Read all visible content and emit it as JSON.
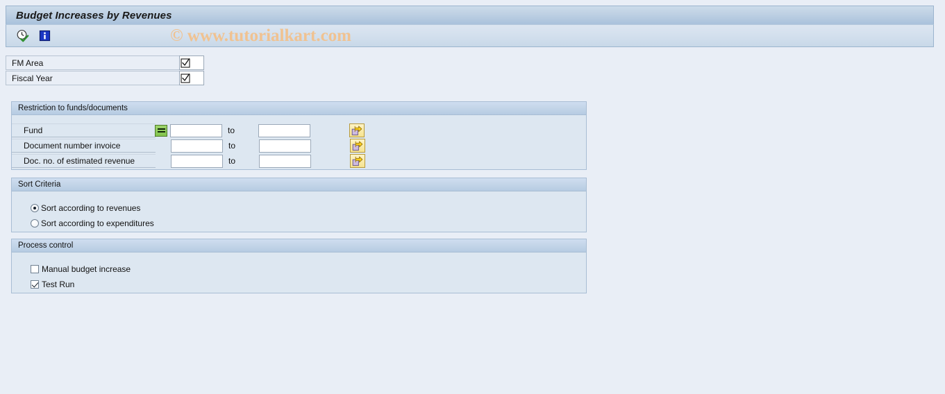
{
  "window": {
    "title": "Budget Increases by Revenues"
  },
  "toolbar": {
    "execute_icon": "clock-check-execute-icon",
    "info_icon": "info-blue-icon"
  },
  "watermark": {
    "text": "© www.tutorialkart.com",
    "color": "#f0c291"
  },
  "header_fields": [
    {
      "label": "FM Area",
      "value": "",
      "icon": "checkbox-search-help-icon"
    },
    {
      "label": "Fiscal Year",
      "value": "",
      "icon": "checkbox-search-help-icon"
    }
  ],
  "groups": {
    "restriction": {
      "title": "Restriction to funds/documents",
      "to_label": "to",
      "rows": [
        {
          "label": "Fund",
          "from_value": "",
          "to_value": "",
          "has_operator_button": true,
          "operator_icon": "equals-green-icon",
          "multi_icon": "multiple-selection-arrow-icon"
        },
        {
          "label": "Document number invoice",
          "from_value": "",
          "to_value": "",
          "has_operator_button": false,
          "multi_icon": "multiple-selection-arrow-icon"
        },
        {
          "label": "Doc. no. of estimated revenue",
          "from_value": "",
          "to_value": "",
          "has_operator_button": false,
          "multi_icon": "multiple-selection-arrow-icon"
        }
      ]
    },
    "sort": {
      "title": "Sort Criteria",
      "options": [
        {
          "label": "Sort according to revenues",
          "selected": true
        },
        {
          "label": "Sort according to expenditures",
          "selected": false
        }
      ]
    },
    "process": {
      "title": "Process control",
      "checkboxes": [
        {
          "label": "Manual budget increase",
          "checked": false
        },
        {
          "label": "Test Run",
          "checked": true
        }
      ]
    }
  }
}
